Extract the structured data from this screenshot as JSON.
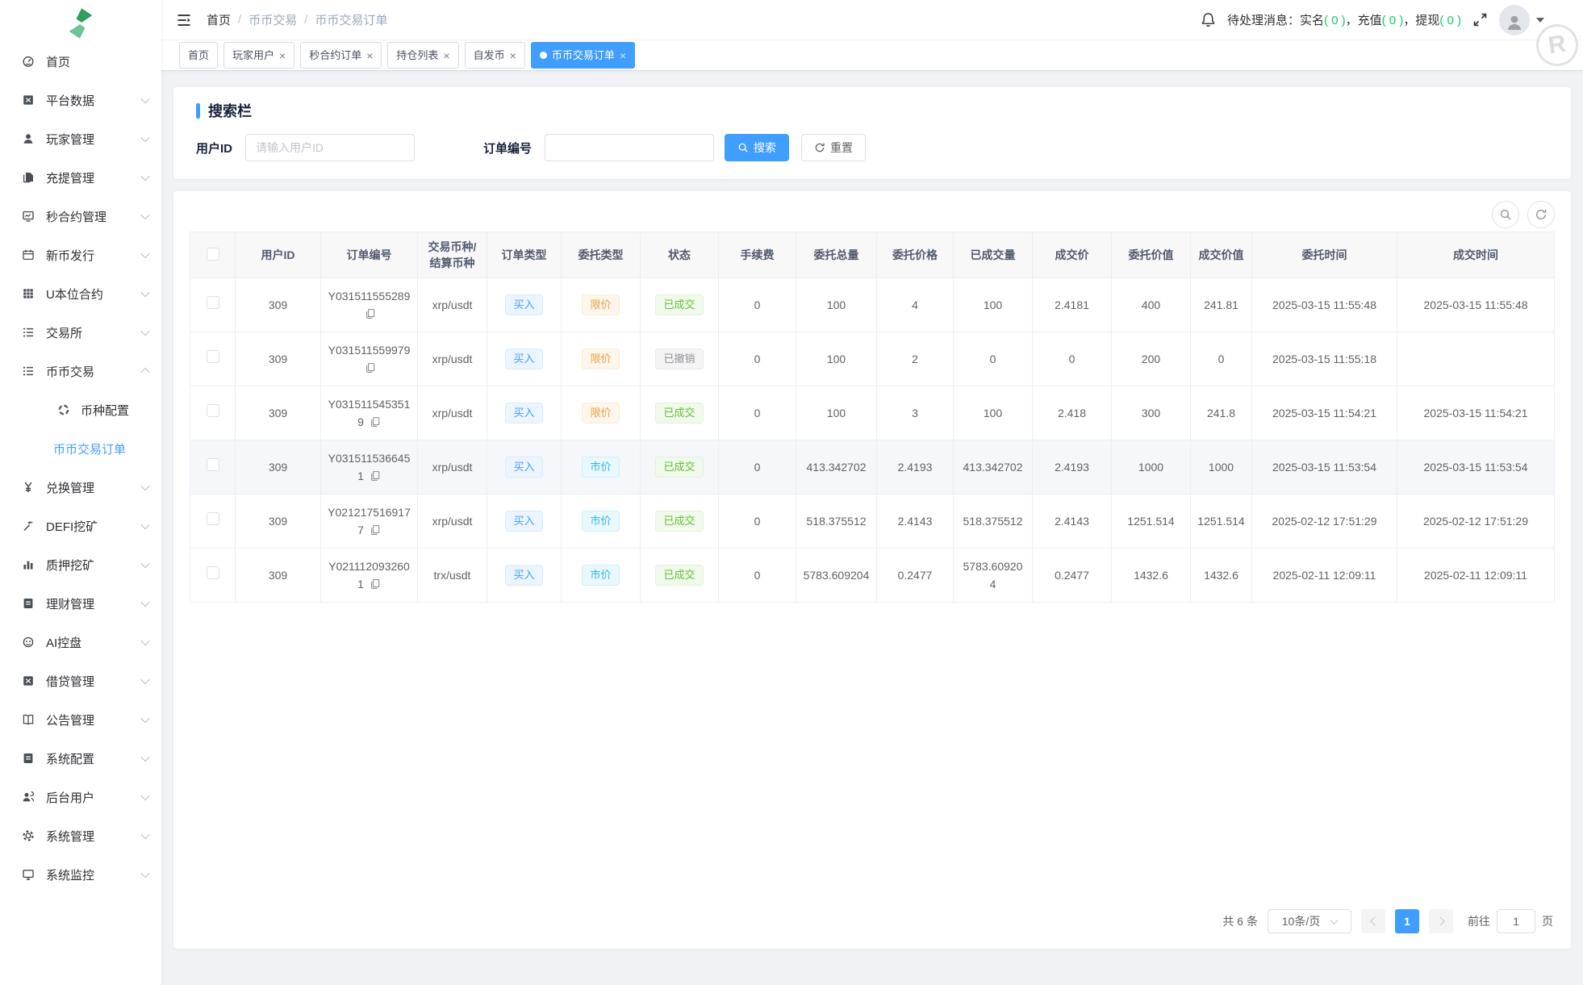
{
  "colors": {
    "accent": "#409eff",
    "success": "#67c23a",
    "warning": "#e6a23c",
    "info": "#909399",
    "market": "#36b6e8",
    "green": "#13ce66"
  },
  "header": {
    "breadcrumb": [
      "首页",
      "币币交易",
      "币币交易订单"
    ],
    "notice": {
      "prefix": "待处理消息：",
      "items": [
        {
          "label": "实名",
          "count": "0"
        },
        {
          "label": "充值",
          "count": "0"
        },
        {
          "label": "提现",
          "count": "0"
        }
      ]
    },
    "icons": {
      "menu_toggle": "hamburger-icon",
      "bell": "bell-icon",
      "fullscreen": "fullscreen-icon",
      "avatar": "user-avatar-icon",
      "watermark": "R"
    }
  },
  "tabs": [
    {
      "label": "首页",
      "closable": false,
      "active": false
    },
    {
      "label": "玩家用户",
      "closable": true,
      "active": false
    },
    {
      "label": "秒合约订单",
      "closable": true,
      "active": false
    },
    {
      "label": "持仓列表",
      "closable": true,
      "active": false
    },
    {
      "label": "自发币",
      "closable": true,
      "active": false
    },
    {
      "label": "币币交易订单",
      "closable": true,
      "active": true
    }
  ],
  "sidebar": {
    "items": [
      {
        "label": "首页",
        "icon": "dashboard-icon",
        "chevron": null
      },
      {
        "label": "平台数据",
        "icon": "platform-data-icon",
        "chevron": "down"
      },
      {
        "label": "玩家管理",
        "icon": "player-manage-icon",
        "chevron": "down"
      },
      {
        "label": "充提管理",
        "icon": "deposit-withdraw-icon",
        "chevron": "down"
      },
      {
        "label": "秒合约管理",
        "icon": "seconds-contract-icon",
        "chevron": "down"
      },
      {
        "label": "新币发行",
        "icon": "new-coin-icon",
        "chevron": "down"
      },
      {
        "label": "U本位合约",
        "icon": "u-contract-icon",
        "chevron": "down"
      },
      {
        "label": "交易所",
        "icon": "exchange-icon",
        "chevron": "down"
      },
      {
        "label": "币币交易",
        "icon": "coin-trade-icon",
        "chevron": "up",
        "children": [
          {
            "label": "币种配置",
            "icon": "coin-config-icon",
            "active": false
          },
          {
            "label": "币币交易订单",
            "icon": null,
            "active": true
          }
        ]
      },
      {
        "label": "兑换管理",
        "icon": "exchange-manage-icon",
        "chevron": "down"
      },
      {
        "label": "DEFI挖矿",
        "icon": "defi-mining-icon",
        "chevron": "down"
      },
      {
        "label": "质押挖矿",
        "icon": "staking-mining-icon",
        "chevron": "down"
      },
      {
        "label": "理财管理",
        "icon": "finance-manage-icon",
        "chevron": "down"
      },
      {
        "label": "AI控盘",
        "icon": "ai-control-icon",
        "chevron": "down"
      },
      {
        "label": "借贷管理",
        "icon": "lending-manage-icon",
        "chevron": "down"
      },
      {
        "label": "公告管理",
        "icon": "announcement-icon",
        "chevron": "down"
      },
      {
        "label": "系统配置",
        "icon": "system-config-icon",
        "chevron": "down"
      },
      {
        "label": "后台用户",
        "icon": "admin-users-icon",
        "chevron": "down"
      },
      {
        "label": "系统管理",
        "icon": "system-manage-icon",
        "chevron": "down"
      },
      {
        "label": "系统监控",
        "icon": "system-monitor-icon",
        "chevron": "down"
      }
    ]
  },
  "search": {
    "title": "搜索栏",
    "user_id_label": "用户ID",
    "user_id_placeholder": "请输入用户ID",
    "order_no_label": "订单编号",
    "order_no_value": "",
    "search_button": "搜索",
    "reset_button": "重置"
  },
  "table": {
    "tools": {
      "search": "table-search-icon",
      "refresh": "table-refresh-icon"
    },
    "columns": [
      "用户ID",
      "订单编号",
      "交易币种/结算币种",
      "订单类型",
      "委托类型",
      "状态",
      "手续费",
      "委托总量",
      "委托价格",
      "已成交量",
      "成交价",
      "委托价值",
      "成交价值",
      "委托时间",
      "成交时间"
    ],
    "rows": [
      {
        "user_id": "309",
        "order_no": "Y031511555289",
        "pair": "xrp/usdt",
        "order_type": "买入",
        "entrust_type": "限价",
        "entrust_kind": "limit",
        "status": "已成交",
        "status_kind": "success",
        "fee": "0",
        "total": "100",
        "price": "4",
        "filled": "100",
        "deal_price": "2.4181",
        "entrust_value": "400",
        "deal_value": "241.81",
        "entrust_time": "2025-03-15 11:55:48",
        "deal_time": "2025-03-15 11:55:48",
        "highlight": false
      },
      {
        "user_id": "309",
        "order_no": "Y031511559979",
        "pair": "xrp/usdt",
        "order_type": "买入",
        "entrust_type": "限价",
        "entrust_kind": "limit",
        "status": "已撤销",
        "status_kind": "cancel",
        "fee": "0",
        "total": "100",
        "price": "2",
        "filled": "0",
        "deal_price": "0",
        "entrust_value": "200",
        "deal_value": "0",
        "entrust_time": "2025-03-15 11:55:18",
        "deal_time": "",
        "highlight": false
      },
      {
        "user_id": "309",
        "order_no": "Y0315115453519",
        "pair": "xrp/usdt",
        "order_type": "买入",
        "entrust_type": "限价",
        "entrust_kind": "limit",
        "status": "已成交",
        "status_kind": "success",
        "fee": "0",
        "total": "100",
        "price": "3",
        "filled": "100",
        "deal_price": "2.418",
        "entrust_value": "300",
        "deal_value": "241.8",
        "entrust_time": "2025-03-15 11:54:21",
        "deal_time": "2025-03-15 11:54:21",
        "highlight": false
      },
      {
        "user_id": "309",
        "order_no": "Y0315115366451",
        "pair": "xrp/usdt",
        "order_type": "买入",
        "entrust_type": "市价",
        "entrust_kind": "market",
        "status": "已成交",
        "status_kind": "success",
        "fee": "0",
        "total": "413.342702",
        "price": "2.4193",
        "filled": "413.342702",
        "deal_price": "2.4193",
        "entrust_value": "1000",
        "deal_value": "1000",
        "entrust_time": "2025-03-15 11:53:54",
        "deal_time": "2025-03-15 11:53:54",
        "highlight": true
      },
      {
        "user_id": "309",
        "order_no": "Y0212175169177",
        "pair": "xrp/usdt",
        "order_type": "买入",
        "entrust_type": "市价",
        "entrust_kind": "market",
        "status": "已成交",
        "status_kind": "success",
        "fee": "0",
        "total": "518.375512",
        "price": "2.4143",
        "filled": "518.375512",
        "deal_price": "2.4143",
        "entrust_value": "1251.514",
        "deal_value": "1251.514",
        "entrust_time": "2025-02-12 17:51:29",
        "deal_time": "2025-02-12 17:51:29",
        "highlight": false
      },
      {
        "user_id": "309",
        "order_no": "Y0211120932601",
        "pair": "trx/usdt",
        "order_type": "买入",
        "entrust_type": "市价",
        "entrust_kind": "market",
        "status": "已成交",
        "status_kind": "success",
        "fee": "0",
        "total": "5783.609204",
        "price": "0.2477",
        "filled": "5783.609204",
        "deal_price": "0.2477",
        "entrust_value": "1432.6",
        "deal_value": "1432.6",
        "entrust_time": "2025-02-11 12:09:11",
        "deal_time": "2025-02-11 12:09:11",
        "highlight": false
      }
    ]
  },
  "pagination": {
    "total_text": "共 6 条",
    "page_size": "10条/页",
    "current": "1",
    "goto_label": "前往",
    "goto_value": "1",
    "goto_suffix": "页"
  }
}
